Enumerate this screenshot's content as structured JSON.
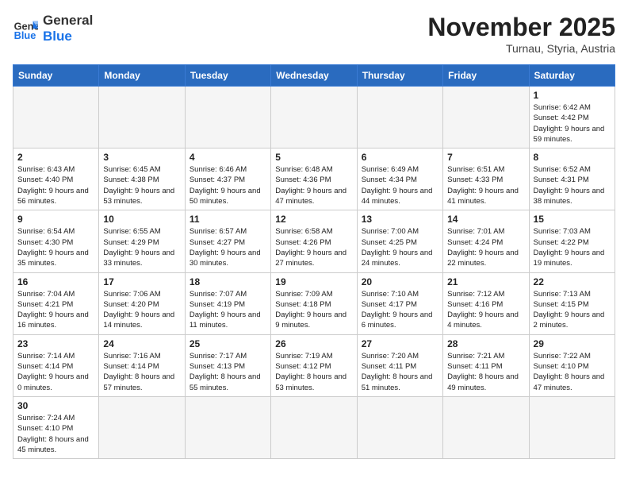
{
  "header": {
    "logo_general": "General",
    "logo_blue": "Blue",
    "month_title": "November 2025",
    "location": "Turnau, Styria, Austria"
  },
  "weekdays": [
    "Sunday",
    "Monday",
    "Tuesday",
    "Wednesday",
    "Thursday",
    "Friday",
    "Saturday"
  ],
  "weeks": [
    [
      {
        "day": "",
        "empty": true
      },
      {
        "day": "",
        "empty": true
      },
      {
        "day": "",
        "empty": true
      },
      {
        "day": "",
        "empty": true
      },
      {
        "day": "",
        "empty": true
      },
      {
        "day": "",
        "empty": true
      },
      {
        "day": "1",
        "sunrise": "6:42 AM",
        "sunset": "4:42 PM",
        "daylight": "9 hours and 59 minutes."
      }
    ],
    [
      {
        "day": "2",
        "sunrise": "6:43 AM",
        "sunset": "4:40 PM",
        "daylight": "9 hours and 56 minutes."
      },
      {
        "day": "3",
        "sunrise": "6:45 AM",
        "sunset": "4:38 PM",
        "daylight": "9 hours and 53 minutes."
      },
      {
        "day": "4",
        "sunrise": "6:46 AM",
        "sunset": "4:37 PM",
        "daylight": "9 hours and 50 minutes."
      },
      {
        "day": "5",
        "sunrise": "6:48 AM",
        "sunset": "4:36 PM",
        "daylight": "9 hours and 47 minutes."
      },
      {
        "day": "6",
        "sunrise": "6:49 AM",
        "sunset": "4:34 PM",
        "daylight": "9 hours and 44 minutes."
      },
      {
        "day": "7",
        "sunrise": "6:51 AM",
        "sunset": "4:33 PM",
        "daylight": "9 hours and 41 minutes."
      },
      {
        "day": "8",
        "sunrise": "6:52 AM",
        "sunset": "4:31 PM",
        "daylight": "9 hours and 38 minutes."
      }
    ],
    [
      {
        "day": "9",
        "sunrise": "6:54 AM",
        "sunset": "4:30 PM",
        "daylight": "9 hours and 35 minutes."
      },
      {
        "day": "10",
        "sunrise": "6:55 AM",
        "sunset": "4:29 PM",
        "daylight": "9 hours and 33 minutes."
      },
      {
        "day": "11",
        "sunrise": "6:57 AM",
        "sunset": "4:27 PM",
        "daylight": "9 hours and 30 minutes."
      },
      {
        "day": "12",
        "sunrise": "6:58 AM",
        "sunset": "4:26 PM",
        "daylight": "9 hours and 27 minutes."
      },
      {
        "day": "13",
        "sunrise": "7:00 AM",
        "sunset": "4:25 PM",
        "daylight": "9 hours and 24 minutes."
      },
      {
        "day": "14",
        "sunrise": "7:01 AM",
        "sunset": "4:24 PM",
        "daylight": "9 hours and 22 minutes."
      },
      {
        "day": "15",
        "sunrise": "7:03 AM",
        "sunset": "4:22 PM",
        "daylight": "9 hours and 19 minutes."
      }
    ],
    [
      {
        "day": "16",
        "sunrise": "7:04 AM",
        "sunset": "4:21 PM",
        "daylight": "9 hours and 16 minutes."
      },
      {
        "day": "17",
        "sunrise": "7:06 AM",
        "sunset": "4:20 PM",
        "daylight": "9 hours and 14 minutes."
      },
      {
        "day": "18",
        "sunrise": "7:07 AM",
        "sunset": "4:19 PM",
        "daylight": "9 hours and 11 minutes."
      },
      {
        "day": "19",
        "sunrise": "7:09 AM",
        "sunset": "4:18 PM",
        "daylight": "9 hours and 9 minutes."
      },
      {
        "day": "20",
        "sunrise": "7:10 AM",
        "sunset": "4:17 PM",
        "daylight": "9 hours and 6 minutes."
      },
      {
        "day": "21",
        "sunrise": "7:12 AM",
        "sunset": "4:16 PM",
        "daylight": "9 hours and 4 minutes."
      },
      {
        "day": "22",
        "sunrise": "7:13 AM",
        "sunset": "4:15 PM",
        "daylight": "9 hours and 2 minutes."
      }
    ],
    [
      {
        "day": "23",
        "sunrise": "7:14 AM",
        "sunset": "4:14 PM",
        "daylight": "9 hours and 0 minutes."
      },
      {
        "day": "24",
        "sunrise": "7:16 AM",
        "sunset": "4:14 PM",
        "daylight": "8 hours and 57 minutes."
      },
      {
        "day": "25",
        "sunrise": "7:17 AM",
        "sunset": "4:13 PM",
        "daylight": "8 hours and 55 minutes."
      },
      {
        "day": "26",
        "sunrise": "7:19 AM",
        "sunset": "4:12 PM",
        "daylight": "8 hours and 53 minutes."
      },
      {
        "day": "27",
        "sunrise": "7:20 AM",
        "sunset": "4:11 PM",
        "daylight": "8 hours and 51 minutes."
      },
      {
        "day": "28",
        "sunrise": "7:21 AM",
        "sunset": "4:11 PM",
        "daylight": "8 hours and 49 minutes."
      },
      {
        "day": "29",
        "sunrise": "7:22 AM",
        "sunset": "4:10 PM",
        "daylight": "8 hours and 47 minutes."
      }
    ],
    [
      {
        "day": "30",
        "sunrise": "7:24 AM",
        "sunset": "4:10 PM",
        "daylight": "8 hours and 45 minutes."
      },
      {
        "day": "",
        "empty": true
      },
      {
        "day": "",
        "empty": true
      },
      {
        "day": "",
        "empty": true
      },
      {
        "day": "",
        "empty": true
      },
      {
        "day": "",
        "empty": true
      },
      {
        "day": "",
        "empty": true
      }
    ]
  ]
}
